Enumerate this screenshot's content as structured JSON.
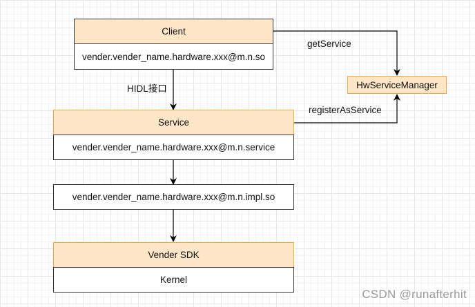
{
  "diagram": {
    "client": {
      "title": "Client",
      "library": "vender.vender_name.hardware.xxx@m.n.so"
    },
    "interface_label": "HIDL接口",
    "service": {
      "title": "Service",
      "binary": "vender.vender_name.hardware.xxx@m.n.service"
    },
    "impl": "vender.vender_name.hardware.xxx@m.n.impl.so",
    "vendor": {
      "title": "Vender SDK",
      "kernel": "Kernel"
    },
    "manager": "HwServiceManager",
    "edges": {
      "get": "getService",
      "register": "registerAsService"
    }
  },
  "watermark": "CSDN @runafterhit"
}
